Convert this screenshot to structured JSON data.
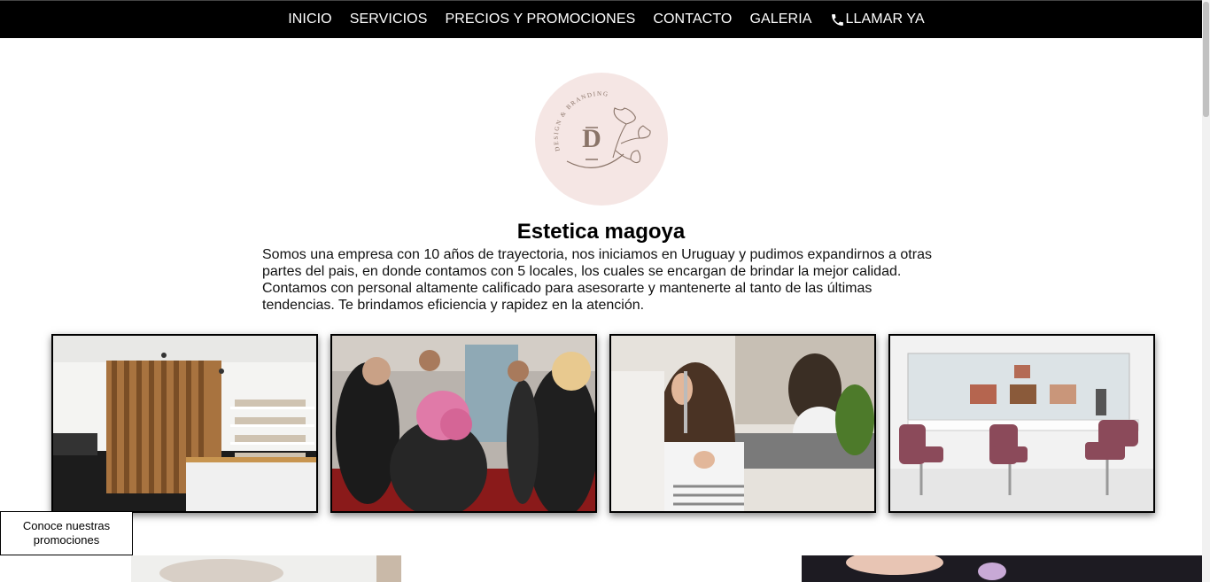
{
  "nav": {
    "items": [
      "INICIO",
      "SERVICIOS",
      "PRECIOS Y PROMOCIONES",
      "CONTACTO",
      "GALERIA"
    ],
    "call_label": "LLAMAR YA"
  },
  "logo": {
    "letter": "D",
    "arc_text": "DESIGN & BRANDING"
  },
  "main": {
    "title": "Estetica magoya",
    "description": "Somos una empresa con 10 años de trayectoria, nos iniciamos en Uruguay y pudimos expandirnos a otras partes del pais, en donde contamos con 5 locales, los cuales se encargan de brindar la mejor calidad. Contamos con personal altamente calificado para asesorarte y mantenerte al tanto de las últimas tendencias. Te brindamos eficiencia y rapidez en la atención."
  },
  "promo_button": {
    "label": "Conoce nuestras promociones"
  },
  "colors": {
    "nav_bg": "#000000",
    "logo_bg": "#f5e6e4",
    "accent_pink": "#e07aa8",
    "chair": "#8b4a5a"
  },
  "icons": [
    "phone-icon"
  ]
}
